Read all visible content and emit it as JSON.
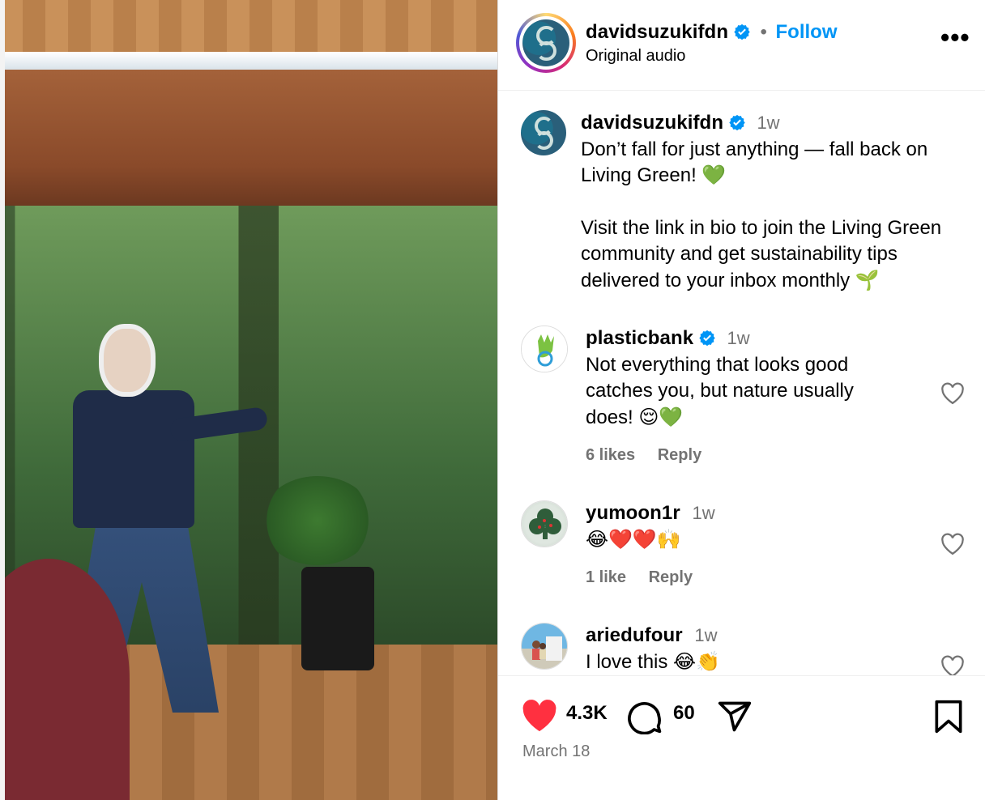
{
  "post": {
    "account": "davidsuzukifdn",
    "follow_label": "Follow",
    "separator": "•",
    "audio": "Original audio",
    "more_label": "•••"
  },
  "caption": {
    "username": "davidsuzukifdn",
    "time": "1w",
    "line1": "Don’t fall for just anything — fall back on Living Green! 💚",
    "line2": "Visit the link in bio to join the Living Green community and get sustainability tips delivered to your inbox monthly 🌱"
  },
  "comments": [
    {
      "username": "plasticbank",
      "verified": true,
      "time": "1w",
      "text": "Not everything that looks good catches you, but nature usually does! 😌💚",
      "likes": "6 likes",
      "reply": "Reply"
    },
    {
      "username": "yumoon1r",
      "verified": false,
      "time": "1w",
      "text": "😂❤️❤️🙌",
      "likes": "1 like",
      "reply": "Reply"
    },
    {
      "username": "ariedufour",
      "verified": false,
      "time": "1w",
      "text": "I love this 😂👏"
    }
  ],
  "actions": {
    "likes_count": "4.3K",
    "comments_count": "60",
    "date": "March 18"
  },
  "colors": {
    "follow_blue": "#0095f6",
    "like_red": "#ff3040",
    "muted_gray": "#737373"
  },
  "icons": {
    "verified": "verified-badge-icon",
    "like": "heart-icon",
    "comment": "comment-icon",
    "share": "share-icon",
    "save": "bookmark-icon"
  }
}
